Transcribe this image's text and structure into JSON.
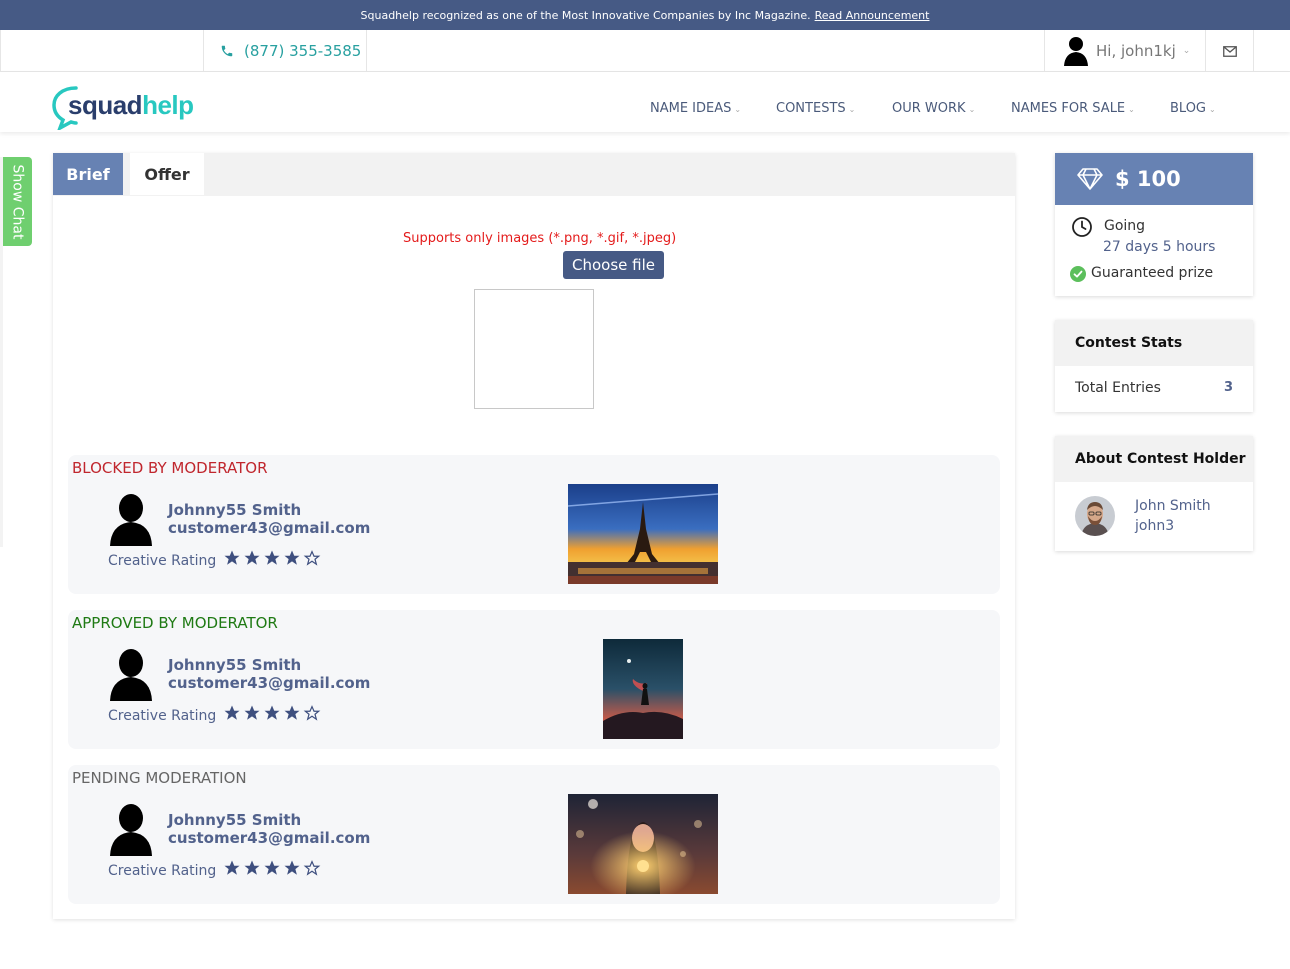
{
  "announcement": {
    "text": "Squadhelp recognized as one of the Most Innovative Companies by Inc Magazine.",
    "link": "Read Announcement"
  },
  "contact": {
    "phone": "(877) 355-3585",
    "user_greeting": "Hi, john1kj"
  },
  "brand": {
    "logo_part1": "squad",
    "logo_part2": "help",
    "colors": {
      "dark": "#2a3e6c",
      "teal": "#28c8c0",
      "accent": "#6782b3"
    }
  },
  "nav": {
    "items": [
      "NAME IDEAS",
      "CONTESTS",
      "OUR WORK",
      "NAMES FOR SALE",
      "BLOG"
    ]
  },
  "show_chat": "Show Chat",
  "tabs": {
    "brief": "Brief",
    "offer": "Offer"
  },
  "upload": {
    "support_text": "Supports only images (*.png, *.gif, *.jpeg)",
    "choose_label": "Choose file"
  },
  "offers": [
    {
      "status": "BLOCKED BY MODERATOR",
      "status_kind": "blocked",
      "name": "Johnny55 Smith",
      "email": "customer43@gmail.com",
      "rating_label": "Creative Rating",
      "rating": 4,
      "rating_max": 5,
      "image_icon": "eiffel-tower-photo"
    },
    {
      "status": "APPROVED BY MODERATOR",
      "status_kind": "approved",
      "name": "Johnny55 Smith",
      "email": "customer43@gmail.com",
      "rating_label": "Creative Rating",
      "rating": 4,
      "rating_max": 5,
      "image_icon": "silhouette-photo"
    },
    {
      "status": "PENDING MODERATION",
      "status_kind": "pending",
      "name": "Johnny55 Smith",
      "email": "customer43@gmail.com",
      "rating_label": "Creative Rating",
      "rating": 4,
      "rating_max": 5,
      "image_icon": "girl-with-lights-photo"
    }
  ],
  "prize": {
    "amount": "$ 100",
    "status": "Going",
    "time_left": "27 days 5 hours",
    "guaranteed": "Guaranteed prize"
  },
  "stats": {
    "title": "Contest Stats",
    "total_label": "Total Entries",
    "total_value": "3"
  },
  "holder": {
    "title": "About Contest Holder",
    "name": "John Smith",
    "nick": "john3"
  }
}
